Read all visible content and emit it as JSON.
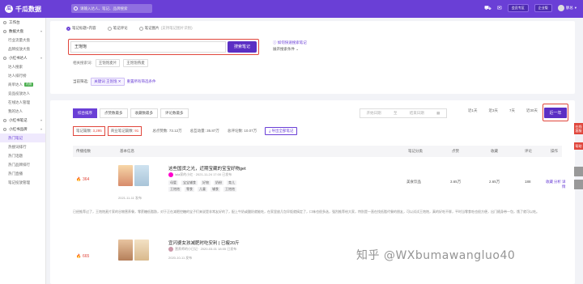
{
  "app": {
    "logo_text": "千瓜数据",
    "logo_mark": "瓜"
  },
  "topbar": {
    "search_placeholder": "请输入达人、笔记、品牌搜索",
    "buttons": [
      "会员专区",
      "企业版"
    ],
    "user_name": "廖总"
  },
  "sidebar": {
    "items": [
      {
        "label": "工作台",
        "type": "group"
      },
      {
        "label": "数据大盘",
        "type": "group"
      },
      {
        "label": "行业流量大盘",
        "type": "sub"
      },
      {
        "label": "品牌投放大盘",
        "type": "sub"
      },
      {
        "label": "小红书达人",
        "type": "group"
      },
      {
        "label": "达人搜索",
        "type": "sub"
      },
      {
        "label": "达人排行榜",
        "type": "sub"
      },
      {
        "label": "商单达人",
        "type": "sub",
        "badge": "内测"
      },
      {
        "label": "竞品投放达人",
        "type": "sub"
      },
      {
        "label": "在线达人管理",
        "type": "sub"
      },
      {
        "label": "我的达人",
        "type": "sub"
      },
      {
        "label": "小红书笔记",
        "type": "group"
      },
      {
        "label": "小红书品牌",
        "type": "group"
      },
      {
        "label": "热门笔记",
        "type": "sub",
        "active": true
      },
      {
        "label": "热搜词排行",
        "type": "sub"
      },
      {
        "label": "热门话题",
        "type": "sub"
      },
      {
        "label": "热门品牌排行",
        "type": "sub"
      },
      {
        "label": "热门直播",
        "type": "sub"
      },
      {
        "label": "笔记投放管理",
        "type": "sub"
      }
    ]
  },
  "search_panel": {
    "modes": [
      "笔记标题+内容",
      "笔记评论",
      "笔记图片"
    ],
    "image_hint": "(支持笔记图片识别)",
    "keyword": "王饱饱",
    "search_button": "搜索笔记",
    "advanced_link": "如何快速搜索笔记",
    "expand_label": "展开搜索条件",
    "history_label": "相关搜索词:",
    "history_chips": [
      "王饱饱麦片",
      "王饱饱燕麦"
    ],
    "filter_label": "当前筛选:",
    "filter_tag": "关键词 王饱饱",
    "filter_clear": "重置所有筛选条件"
  },
  "results": {
    "tabs": [
      "综合排序",
      "点赞数最多",
      "收藏数最多",
      "评论数最多"
    ],
    "date_start": "开始日期",
    "date_sep": "至",
    "date_end": "结束日期",
    "periods": [
      "近1天",
      "近3天",
      "7天",
      "近30天"
    ],
    "active_period": "近一年",
    "stats": {
      "total_notes_label": "笔记篇数:",
      "total_notes": "3,295",
      "business_notes_label": "商业笔记篇数:",
      "business_notes": "91",
      "likes_label": "总点赞数:",
      "likes": "73.12万",
      "interact_label": "总互动量:",
      "interact": "35.87万",
      "comments_label": "总评论数:",
      "comments": "10.07万",
      "export_label": "导出全部笔记"
    },
    "headers": [
      "传播指数",
      "基本信息",
      "笔记分类",
      "点赞",
      "收藏",
      "评论",
      "操作"
    ],
    "rows": [
      {
        "index": "364",
        "title": "这些国货之光，近期宝藏的宝宝好物get",
        "author": "lala家的小红",
        "date": "2021-11-24 17:00 已发布",
        "sub_date": "2021-11-11 发布",
        "tags": [
          "母婴",
          "宝宝辅食",
          "好物",
          "奶粉",
          "育儿",
          "王饱饱",
          "零食",
          "儿童",
          "辅食",
          "王饱饱"
        ],
        "category": "美食饮品",
        "likes": "3.65万",
        "collects": "2.65万",
        "comments": "188",
        "actions": [
          "收藏",
          "分析",
          "详情"
        ]
      },
      {
        "index": "665",
        "title": "宜闪婆女孩减肥时吃安利 | 已瘦20斤",
        "author": "营养师的小日记",
        "date": "2020-03-01 18:05 已发布",
        "sub_date": "2020-10-11 发布",
        "category": "",
        "likes": "",
        "collects": "",
        "comments": "",
        "actions": [
          "收藏",
          "分析",
          "详情"
        ]
      }
    ],
    "content_preview": "已经推荐过了，王饱饱麦片家的谷物营养餐，零蔗糖低脂肪，对于正在减肥控糖的宝子们来说是非常友好的了，配上牛奶或酸奶就能吃，在家里放几包早饭就搞定了，口味也很多选，强烈推荐给大家，特别是一直在找低脂代餐的朋友，可以试试王饱饱，真的好吃不胖，平时当零食吃也很方便，出门随身带一包，饿了就可以吃。"
  },
  "float_bar": {
    "items": [
      "在线客服",
      "帮助"
    ]
  },
  "watermark": "知乎 @WXbumawangluo40",
  "colors": {
    "brand": "#6a3fd6",
    "highlight": "#e0463c"
  }
}
